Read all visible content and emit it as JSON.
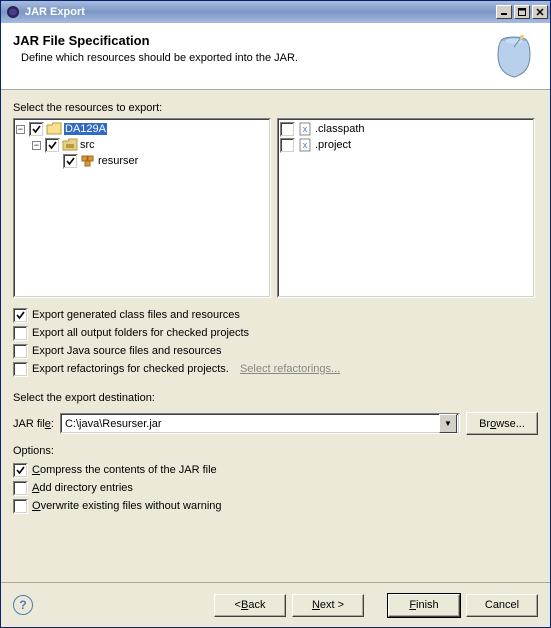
{
  "window": {
    "title": "JAR Export"
  },
  "banner": {
    "heading": "JAR File Specification",
    "description": "Define which resources should be exported into the JAR."
  },
  "left_tree": {
    "label": "Select the resources to export:",
    "items": [
      {
        "name": "DA129A",
        "checked": true,
        "selected": true,
        "icon": "project",
        "level": 0,
        "expander": "minus"
      },
      {
        "name": "src",
        "checked": true,
        "selected": false,
        "icon": "folder-src",
        "level": 1,
        "expander": "minus"
      },
      {
        "name": "resurser",
        "checked": true,
        "selected": false,
        "icon": "package",
        "level": 2,
        "expander": "none"
      }
    ]
  },
  "right_list": {
    "items": [
      {
        "name": ".classpath",
        "checked": false,
        "icon": "xml-file"
      },
      {
        "name": ".project",
        "checked": false,
        "icon": "xml-file"
      }
    ]
  },
  "export_options": [
    {
      "label": "Export generated class files and resources",
      "checked": true
    },
    {
      "label": "Export all output folders for checked projects",
      "checked": false
    },
    {
      "label": "Export Java source files and resources",
      "checked": false
    },
    {
      "label": "Export refactorings for checked projects.",
      "checked": false,
      "link_text": "Select refactorings..."
    }
  ],
  "destination": {
    "label": "Select the export destination:",
    "field_label": "JAR file:",
    "value": "C:\\java\\Resurser.jar",
    "browse": "Browse..."
  },
  "options_section": {
    "label": "Options:",
    "items": [
      {
        "labelPrefix": "C",
        "labelRest": "ompress the contents of the JAR file",
        "checked": true
      },
      {
        "labelPrefix": "A",
        "labelRest": "dd directory entries",
        "checked": false
      },
      {
        "labelPrefix": "O",
        "labelRest": "verwrite existing files without warning",
        "checked": false
      }
    ]
  },
  "buttons": {
    "back": "< Back",
    "next": "Next >",
    "finish": "Finish",
    "cancel": "Cancel"
  }
}
